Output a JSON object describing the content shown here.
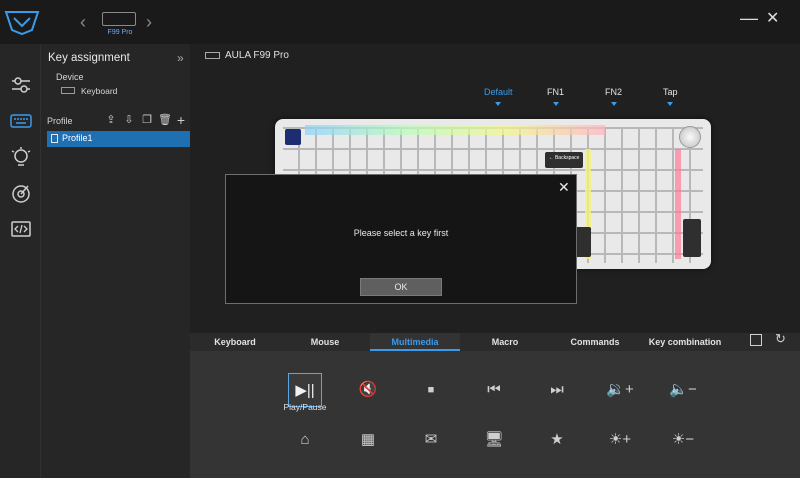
{
  "titlebar": {
    "device_thumbnail_label": "F99 Pro",
    "nav_left": "‹",
    "nav_right": "›",
    "minimize": "—",
    "close": "✕"
  },
  "sidebar": {
    "title": "Key assignment",
    "collapse_icon": "»",
    "device_label": "Device",
    "device_name": "Keyboard",
    "profile_label": "Profile",
    "profile_tools": [
      "export-icon",
      "import-icon",
      "copy-icon",
      "trash-icon",
      "plus-icon"
    ],
    "profiles": [
      {
        "label": "Profile1",
        "selected": true
      }
    ]
  },
  "main": {
    "device_header": "AULA F99 Pro",
    "layers": [
      {
        "label": "Default",
        "active": true
      },
      {
        "label": "FN1",
        "active": false
      },
      {
        "label": "FN2",
        "active": false
      },
      {
        "label": "Tap",
        "active": false
      }
    ],
    "keyboard": {
      "backspace_label": "← Backspace"
    }
  },
  "modal": {
    "close": "✕",
    "message": "Please select a key first",
    "ok_label": "OK"
  },
  "tabs": {
    "keyboard": "Keyboard",
    "mouse": "Mouse",
    "multimedia": "Multimedia",
    "macro": "Macro",
    "commands": "Commands",
    "key_combination": "Key combination",
    "active": "Multimedia"
  },
  "multimedia": {
    "selected_label": "Play/Pause",
    "row1": [
      "play-pause-icon",
      "mute-icon",
      "stop-icon",
      "previous-track-icon",
      "next-track-icon",
      "volume-up-icon",
      "volume-down-icon"
    ],
    "row2": [
      "home-icon",
      "calculator-icon",
      "mail-icon",
      "my-computer-icon",
      "favorites-icon",
      "brightness-up-icon",
      "brightness-down-icon"
    ]
  },
  "colors": {
    "accent": "#3a9bea",
    "profile_selected": "#1f6fb3"
  }
}
